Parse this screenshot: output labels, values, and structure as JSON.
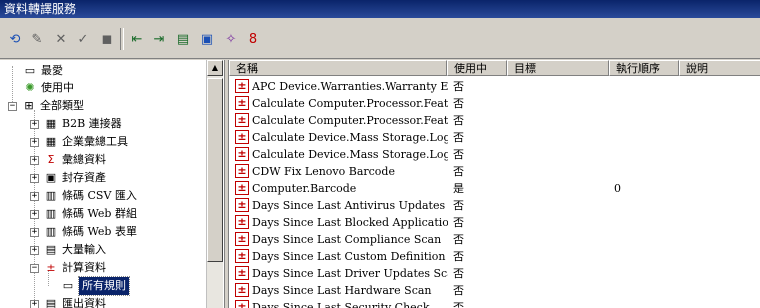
{
  "window": {
    "title": "資料轉譯服務"
  },
  "toolbar": {
    "buttons": [
      {
        "name": "refresh-icon",
        "glyph": "⟲",
        "color": "#1a4fb5"
      },
      {
        "name": "edit-icon",
        "glyph": "✎",
        "color": "#606060"
      },
      {
        "name": "delete-icon",
        "glyph": "✕",
        "color": "#606060"
      },
      {
        "name": "approve-icon",
        "glyph": "✓",
        "color": "#606060"
      },
      {
        "name": "stop-icon",
        "glyph": "◼",
        "color": "#606060"
      },
      {
        "name": "import-icon",
        "glyph": "⇤",
        "color": "#1a6b2a"
      },
      {
        "name": "export-icon",
        "glyph": "⇥",
        "color": "#1a6b2a"
      },
      {
        "name": "report-icon",
        "glyph": "▤",
        "color": "#1a6b2a"
      },
      {
        "name": "properties-icon",
        "glyph": "▣",
        "color": "#1a4fb5"
      },
      {
        "name": "run-icon",
        "glyph": "✧",
        "color": "#7a2fa0"
      },
      {
        "name": "order-icon",
        "glyph": "8",
        "color": "#c00000"
      }
    ]
  },
  "tree": {
    "items": [
      {
        "label": "最愛",
        "icon": "▭",
        "name": "tree-item-favorites"
      },
      {
        "label": "使用中",
        "icon": "✺",
        "name": "tree-item-active"
      },
      {
        "label": "全部類型",
        "icon": "⊞",
        "name": "tree-item-all-types"
      },
      {
        "label": "B2B 連接器",
        "icon": "▦",
        "name": "tree-item-b2b-connector"
      },
      {
        "label": "企業彙總工具",
        "icon": "▦",
        "name": "tree-item-enterprise-rollup"
      },
      {
        "label": "彙總資料",
        "icon": "Σ",
        "name": "tree-item-rollup-data"
      },
      {
        "label": "封存資產",
        "icon": "▣",
        "name": "tree-item-archived-assets"
      },
      {
        "label": "條碼 CSV 匯入",
        "icon": "▥",
        "name": "tree-item-barcode-csv-import"
      },
      {
        "label": "條碼 Web 群組",
        "icon": "▥",
        "name": "tree-item-barcode-web-group"
      },
      {
        "label": "條碼 Web 表單",
        "icon": "▥",
        "name": "tree-item-barcode-web-form"
      },
      {
        "label": "大量輸入",
        "icon": "▤",
        "name": "tree-item-bulk-input"
      },
      {
        "label": "計算資料",
        "icon": "±",
        "name": "tree-item-computed-data"
      },
      {
        "label": "所有規則",
        "icon": "▭",
        "name": "tree-item-all-rules"
      },
      {
        "label": "匯出資料",
        "icon": "▤",
        "name": "tree-item-export-data"
      }
    ]
  },
  "list": {
    "columns": [
      "名稱",
      "使用中",
      "目標",
      "執行順序",
      "說明"
    ],
    "rows": [
      {
        "name": "APC Device.Warranties.Warranty Expi...",
        "active": "否",
        "order": ""
      },
      {
        "name": "Calculate Computer.Processor.Features....",
        "active": "否",
        "order": ""
      },
      {
        "name": "Calculate Computer.Processor.Features....",
        "active": "否",
        "order": ""
      },
      {
        "name": "Calculate Device.Mass Storage.Logical ...",
        "active": "否",
        "order": ""
      },
      {
        "name": "Calculate Device.Mass Storage.Logical ...",
        "active": "否",
        "order": ""
      },
      {
        "name": "CDW Fix Lenovo Barcode",
        "active": "否",
        "order": ""
      },
      {
        "name": "Computer.Barcode",
        "active": "是",
        "order": "0"
      },
      {
        "name": "Days Since Last Antivirus Updates Scan",
        "active": "否",
        "order": ""
      },
      {
        "name": "Days Since Last Blocked Application S...",
        "active": "否",
        "order": ""
      },
      {
        "name": "Days Since Last Compliance Scan",
        "active": "否",
        "order": ""
      },
      {
        "name": "Days Since Last Custom Definition Scan",
        "active": "否",
        "order": ""
      },
      {
        "name": "Days Since Last Driver Updates Scan",
        "active": "否",
        "order": ""
      },
      {
        "name": "Days Since Last Hardware Scan",
        "active": "否",
        "order": ""
      },
      {
        "name": "Days Since Last Security Check",
        "active": "否",
        "order": ""
      }
    ]
  }
}
